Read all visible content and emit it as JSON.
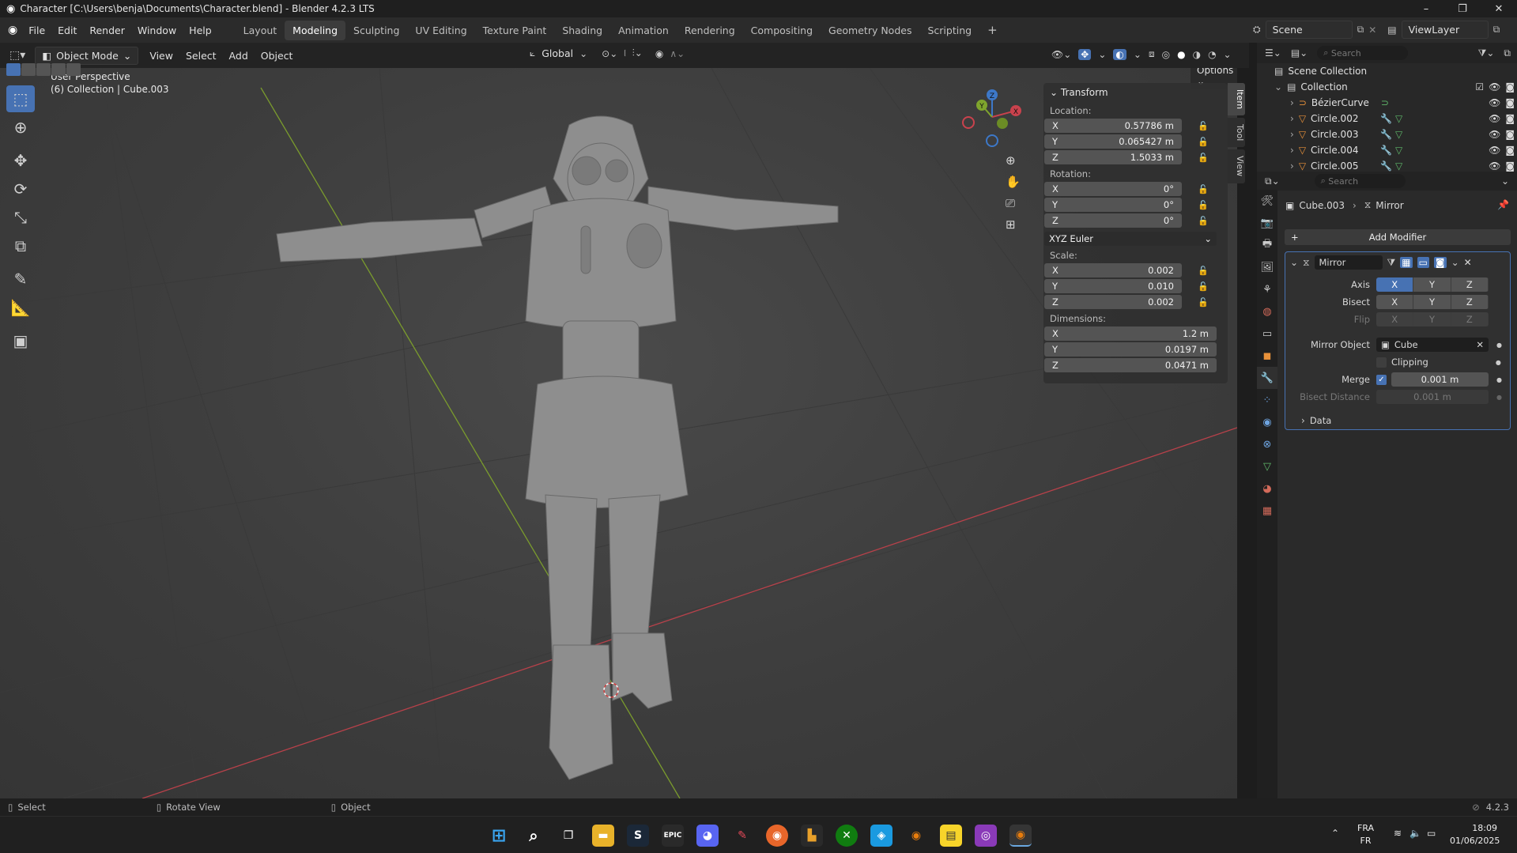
{
  "window": {
    "title": "Character [C:\\Users\\benja\\Documents\\Character.blend] - Blender 4.2.3 LTS",
    "min": "–",
    "max": "❐",
    "close": "✕"
  },
  "menu": {
    "items": [
      "File",
      "Edit",
      "Render",
      "Window",
      "Help"
    ],
    "workspaces": [
      "Layout",
      "Modeling",
      "Sculpting",
      "UV Editing",
      "Texture Paint",
      "Shading",
      "Animation",
      "Rendering",
      "Compositing",
      "Geometry Nodes",
      "Scripting"
    ],
    "active_workspace": "Modeling",
    "scene": "Scene",
    "view_layer": "ViewLayer"
  },
  "viewport_header": {
    "mode": "Object Mode",
    "menus": [
      "View",
      "Select",
      "Add",
      "Object"
    ],
    "orientation": "Global",
    "options": "Options"
  },
  "viewport": {
    "perspective": "User Perspective",
    "collection_info": "(6) Collection | Cube.003",
    "gizmo": {
      "x": "X",
      "y": "Y",
      "z": "Z"
    }
  },
  "npanel": {
    "section": "Transform",
    "location_label": "Location:",
    "location": [
      {
        "axis": "X",
        "value": "0.57786 m"
      },
      {
        "axis": "Y",
        "value": "0.065427 m"
      },
      {
        "axis": "Z",
        "value": "1.5033 m"
      }
    ],
    "rotation_label": "Rotation:",
    "rotation": [
      {
        "axis": "X",
        "value": "0°"
      },
      {
        "axis": "Y",
        "value": "0°"
      },
      {
        "axis": "Z",
        "value": "0°"
      }
    ],
    "rotation_mode": "XYZ Euler",
    "scale_label": "Scale:",
    "scale": [
      {
        "axis": "X",
        "value": "0.002"
      },
      {
        "axis": "Y",
        "value": "0.010"
      },
      {
        "axis": "Z",
        "value": "0.002"
      }
    ],
    "dimensions_label": "Dimensions:",
    "dimensions": [
      {
        "axis": "X",
        "value": "1.2 m"
      },
      {
        "axis": "Y",
        "value": "0.0197 m"
      },
      {
        "axis": "Z",
        "value": "0.0471 m"
      }
    ],
    "tabs": [
      "Item",
      "Tool",
      "View"
    ]
  },
  "outliner": {
    "search_placeholder": "Search",
    "scene_collection": "Scene Collection",
    "collection": "Collection",
    "items": [
      "BézierCurve",
      "Circle.002",
      "Circle.003",
      "Circle.004",
      "Circle.005"
    ]
  },
  "properties": {
    "search_placeholder": "Search",
    "object": "Cube.003",
    "modifier_crumb": "Mirror",
    "add_modifier": "Add Modifier",
    "modifier_name": "Mirror",
    "axis_label": "Axis",
    "bisect_label": "Bisect",
    "flip_label": "Flip",
    "xyz": [
      "X",
      "Y",
      "Z"
    ],
    "mirror_object_label": "Mirror Object",
    "mirror_object": "Cube",
    "clipping": "Clipping",
    "merge_label": "Merge",
    "merge_value": "0.001 m",
    "bisect_distance_label": "Bisect Distance",
    "bisect_distance_value": "0.001 m",
    "data": "Data"
  },
  "statusbar": {
    "select": "Select",
    "rotate": "Rotate View",
    "object": "Object",
    "version": "4.2.3"
  },
  "taskbar": {
    "lang1": "FRA",
    "lang2": "FR",
    "time": "18:09",
    "date": "01/06/2025"
  },
  "colors": {
    "accent": "#4772b3",
    "x_axis": "#c9424d",
    "y_axis": "#7fa52d",
    "z_axis": "#3d78c8"
  }
}
